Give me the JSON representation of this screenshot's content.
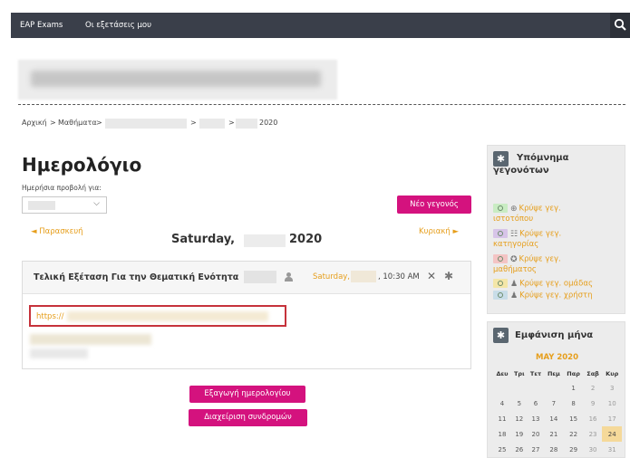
{
  "navbar": {
    "brand": "EAP Exams",
    "my_exams": "Οι εξετάσεις μου",
    "search_icon": "search-icon"
  },
  "breadcrumb": {
    "home": "Αρχική",
    "courses": "Μαθήματα",
    "sep": ">",
    "year": "2020"
  },
  "page": {
    "title": "Ημερολόγιο",
    "day_view_label": "Ημερήσια προβολή για:",
    "select_chevron": "⌵",
    "new_event": "Νέο γεγονός",
    "prev_day": "◄  Παρασκευή",
    "next_day": "Κυριακή  ►",
    "day_heading_prefix": "Saturday,",
    "day_heading_year": "2020"
  },
  "event": {
    "title": "Τελική Εξέταση Για την Θεματική Ενότητα",
    "date_prefix": "Saturday,",
    "time": ", 10:30 AM",
    "close_glyph": "✕",
    "gear_glyph": "✱",
    "link_prefix": "https://"
  },
  "buttons": {
    "export": "Εξαγωγή ημερολογίου",
    "subscriptions": "Διαχείριση συνδρομών"
  },
  "legend": {
    "title_line1": "Υπόμνημα",
    "title_line2": "γεγονότων",
    "icon_glyph": "✱",
    "rows": [
      {
        "label_a": "Κρύψε γεγ.",
        "label_b": "ιστοτόπου",
        "color": "#c9ecc3",
        "icon": "⊕"
      },
      {
        "label_a": "Κρύψε γεγ.",
        "label_b": "κατηγορίας",
        "color": "#d7c4e8",
        "icon": "☷"
      },
      {
        "label_a": "Κρύψε γεγ.",
        "label_b": "μαθήματος",
        "color": "#f4c4c4",
        "icon": "✪"
      },
      {
        "label_a": "Κρύψε γεγ. ομάδας",
        "label_b": "",
        "color": "#f4e6a8",
        "icon": "♟"
      },
      {
        "label_a": "Κρύψε γεγ. χρήστη",
        "label_b": "",
        "color": "#c8dde8",
        "icon": "♟"
      }
    ]
  },
  "month": {
    "title": "Εμφάνιση μήνα",
    "icon_glyph": "✱",
    "month_label": "MAY 2020",
    "headers": [
      "Δευ",
      "Τρι",
      "Τετ",
      "Πεμ",
      "Παρ",
      "Σαβ",
      "Κυρ"
    ],
    "weeks": [
      [
        "",
        "",
        "",
        "",
        "1",
        "2",
        "3"
      ],
      [
        "4",
        "5",
        "6",
        "7",
        "8",
        "9",
        "10"
      ],
      [
        "11",
        "12",
        "13",
        "14",
        "15",
        "16",
        "17"
      ],
      [
        "18",
        "19",
        "20",
        "21",
        "22",
        "23",
        "24"
      ],
      [
        "25",
        "26",
        "27",
        "28",
        "29",
        "30",
        "31"
      ]
    ],
    "today": "24"
  }
}
